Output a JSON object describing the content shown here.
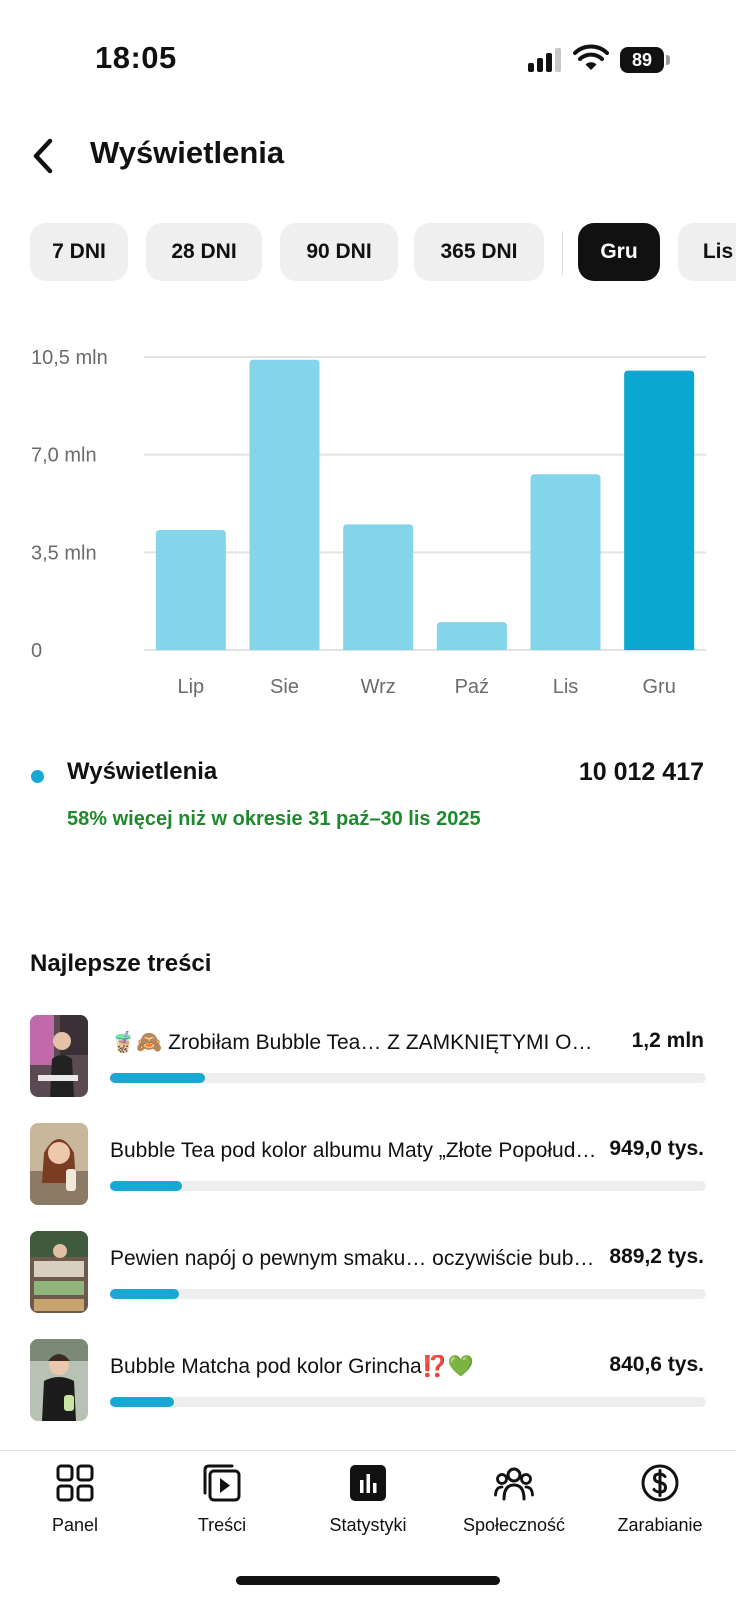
{
  "status_bar": {
    "time": "18:05",
    "battery": "89"
  },
  "header": {
    "title": "Wyświetlenia",
    "back_icon": "chevron-left-icon"
  },
  "filters": [
    {
      "label": "7 DNI",
      "active": false
    },
    {
      "label": "28 DNI",
      "active": false
    },
    {
      "label": "90 DNI",
      "active": false
    },
    {
      "label": "365 DNI",
      "active": false
    },
    {
      "label": "Gru",
      "active": true
    },
    {
      "label": "Lis",
      "active": false
    }
  ],
  "chart_data": {
    "type": "bar",
    "categories": [
      "Lip",
      "Sie",
      "Wrz",
      "Paź",
      "Lis",
      "Gru"
    ],
    "values": [
      4300000,
      10400000,
      4500000,
      1000000,
      6300000,
      10012417
    ],
    "highlighted_category": "Gru",
    "y_ticks": [
      "10,5 mln",
      "7,0 mln",
      "3,5 mln",
      "0"
    ],
    "y_tick_values": [
      10500000,
      7000000,
      3500000,
      0
    ],
    "ylim": [
      0,
      10500000
    ],
    "grid": true,
    "colors": {
      "bar": "#84d4ea",
      "highlight": "#0aa7d0"
    }
  },
  "summary": {
    "label": "Wyświetlenia",
    "value": "10 012 417",
    "comparison": "58% więcej niż w okresie 31 paź–30 lis 2025",
    "comparison_color": "#1e8a2e"
  },
  "top_content": {
    "title": "Najlepsze treści",
    "items": [
      {
        "title": "🧋🙈 Zrobiłam Bubble Tea… Z ZAMKNIĘTYMI OCZAMI",
        "value": "1,2 mln",
        "progress": 0.16
      },
      {
        "title": "Bubble Tea pod kolor albumu Maty „Złote Popołudnie”",
        "value": "949,0 tys.",
        "progress": 0.12
      },
      {
        "title": "Pewien napój o pewnym smaku… oczywiście bubble tea",
        "value": "889,2 tys.",
        "progress": 0.115
      },
      {
        "title": "Bubble Matcha pod kolor Grincha⁉️💚",
        "value": "840,6 tys.",
        "progress": 0.108
      }
    ]
  },
  "bottom_nav": [
    {
      "label": "Panel",
      "icon": "dashboard-icon"
    },
    {
      "label": "Treści",
      "icon": "content-play-icon"
    },
    {
      "label": "Statystyki",
      "icon": "stats-icon",
      "active": true
    },
    {
      "label": "Społeczność",
      "icon": "community-icon"
    },
    {
      "label": "Zarabianie",
      "icon": "dollar-icon"
    }
  ]
}
